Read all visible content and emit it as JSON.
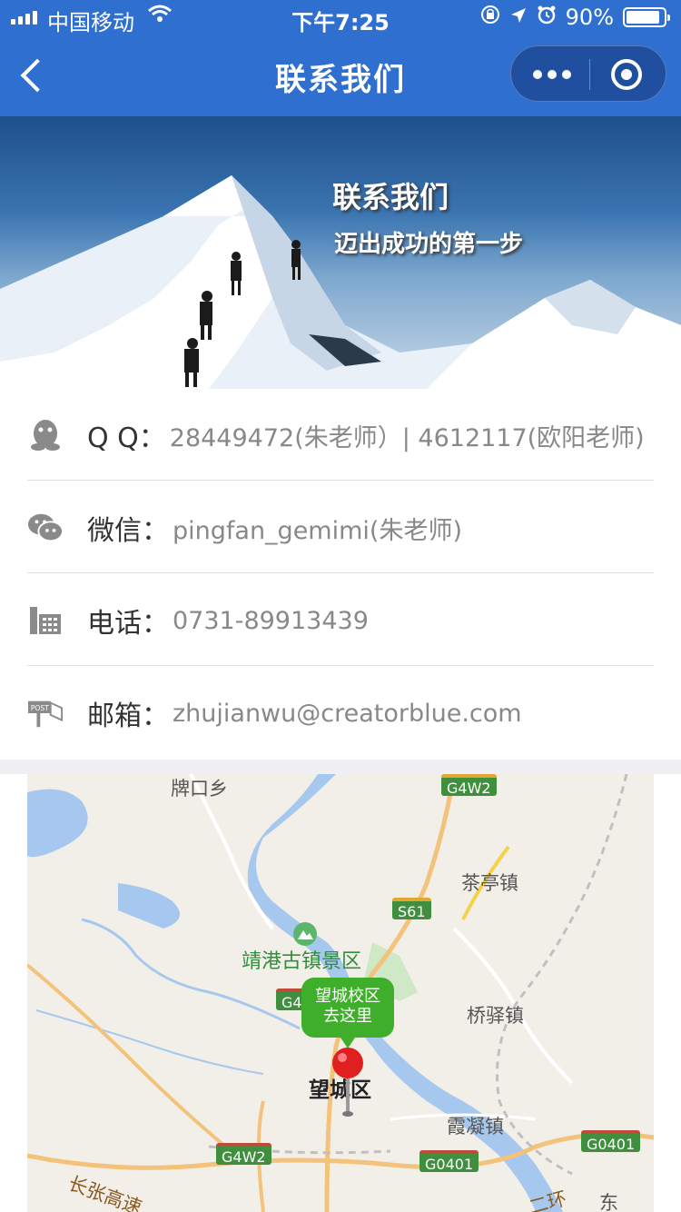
{
  "status_bar": {
    "carrier": "中国移动",
    "time": "下午7:25",
    "battery": "90%",
    "battery_level": 0.9
  },
  "nav": {
    "title": "联系我们"
  },
  "banner": {
    "line1": "联系我们",
    "line2": "迈出成功的第一步"
  },
  "contacts": [
    {
      "icon": "qq-penguin-icon",
      "label": "Q Q：",
      "value": "28449472(朱老师）| 4612117(欧阳老师)"
    },
    {
      "icon": "wechat-icon",
      "label": "微信：",
      "value": "pingfan_gemimi(朱老师)"
    },
    {
      "icon": "telephone-icon",
      "label": "电话：",
      "value": "0731-89913439"
    },
    {
      "icon": "mailbox-icon",
      "label": "邮箱：",
      "value": "zhujianwu@creatorblue.com"
    }
  ],
  "map": {
    "places": {
      "p1": "牌口乡",
      "p2": "茶亭镇",
      "p3": "桥驿镇",
      "p4": "霞凝镇",
      "p5": "望城区",
      "p6": "长张高速",
      "p7": "东",
      "p8": "二环"
    },
    "scenic": "靖港古镇景区",
    "roads": {
      "r1": "G4W2",
      "r2": "S61",
      "r3": "G4",
      "r4": "G4W2",
      "r5": "G0401",
      "r6": "G0401"
    },
    "marker": {
      "line1": "望城校区",
      "line2": "去这里"
    }
  },
  "colors": {
    "nav_bg": "#2f6fd0",
    "marker_bubble": "#3fae2a",
    "pin": "#e02020"
  }
}
